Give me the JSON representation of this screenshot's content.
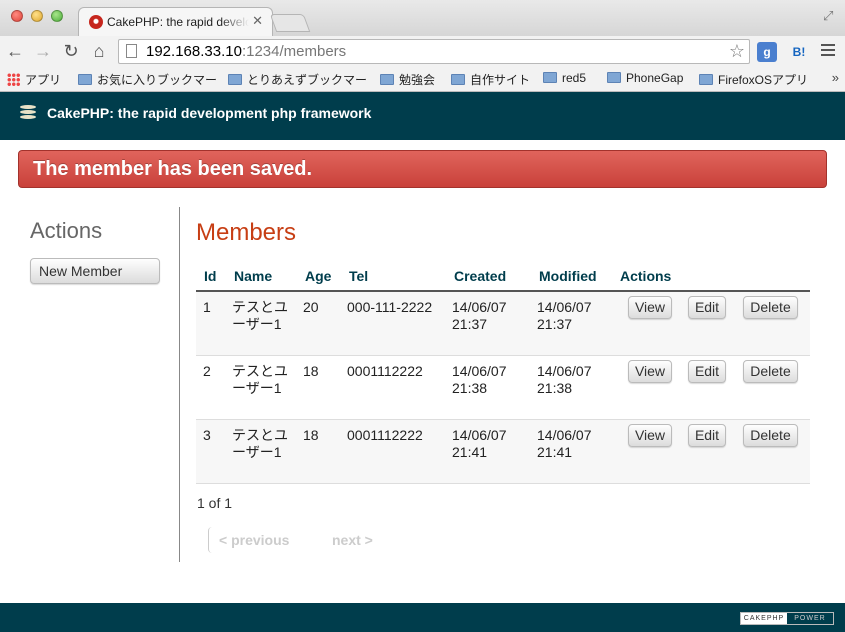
{
  "browser": {
    "tab_title": "CakePHP: the rapid development php framework",
    "tab_close": "✕",
    "url_host": "192.168.33.10",
    "url_rest": ":1234/members",
    "bookmarks": [
      {
        "label": "アプリ",
        "icon": "apps-icon"
      },
      {
        "label": "お気に入りブックマー",
        "icon": "folder-icon"
      },
      {
        "label": "とりあえずブックマー",
        "icon": "folder-icon"
      },
      {
        "label": "勉強会",
        "icon": "folder-icon"
      },
      {
        "label": "自作サイト",
        "icon": "folder-icon"
      },
      {
        "label": "red5",
        "icon": "folder-icon"
      },
      {
        "label": "PhoneGap",
        "icon": "folder-icon"
      },
      {
        "label": "FirefoxOSアプリ",
        "icon": "folder-icon"
      }
    ],
    "bookmarks_more": "»",
    "ext_g": "g",
    "ext_b": "B!"
  },
  "header": {
    "title": "CakePHP: the rapid development php framework"
  },
  "flash": {
    "message": "The member has been saved."
  },
  "sidebar": {
    "title": "Actions",
    "new_member_label": "New Member"
  },
  "main": {
    "title": "Members",
    "columns": [
      "Id",
      "Name",
      "Age",
      "Tel",
      "Created",
      "Modified",
      "Actions"
    ],
    "rows": [
      {
        "id": "1",
        "name": "テスとユーザー1",
        "age": "20",
        "tel": "000-111-2222",
        "created": "14/06/07 21:37",
        "modified": "14/06/07 21:37"
      },
      {
        "id": "2",
        "name": "テスとユーザー1",
        "age": "18",
        "tel": "0001112222",
        "created": "14/06/07 21:38",
        "modified": "14/06/07 21:38"
      },
      {
        "id": "3",
        "name": "テスとユーザー1",
        "age": "18",
        "tel": "0001112222",
        "created": "14/06/07 21:41",
        "modified": "14/06/07 21:41"
      }
    ],
    "row_actions": {
      "view": "View",
      "edit": "Edit",
      "delete": "Delete"
    },
    "counter": "1 of 1",
    "previous_label": "< previous",
    "next_label": "next >"
  },
  "footer": {
    "badge_left": "CAKEPHP",
    "badge_right": "POWER"
  },
  "colors": {
    "header_bg": "#003d4c",
    "flash_bg": "#c9413a",
    "title_accent": "#c73e14"
  }
}
